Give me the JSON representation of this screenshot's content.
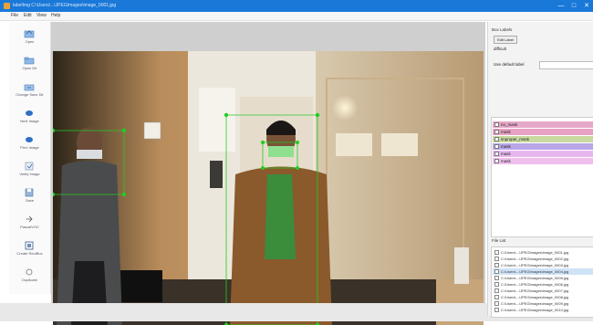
{
  "window": {
    "title": "labelImg C:\\Users\\...\\JPEGImages\\image_0001.jpg",
    "controls": [
      "—",
      "□",
      "✕"
    ]
  },
  "menu": [
    "File",
    "Edit",
    "View",
    "Help"
  ],
  "toolbar": [
    {
      "label": "Open",
      "icon": "open-icon"
    },
    {
      "label": "Open Dir",
      "icon": "open-dir-icon"
    },
    {
      "label": "Change Save Dir",
      "icon": "change-save-dir-icon"
    },
    {
      "label": "Next Image",
      "icon": "next-image-icon"
    },
    {
      "label": "Prev Image",
      "icon": "prev-image-icon"
    },
    {
      "label": "Verify Image",
      "icon": "verify-image-icon"
    },
    {
      "label": "Save",
      "icon": "save-icon"
    },
    {
      "label": "PascalVOC",
      "icon": "format-icon"
    },
    {
      "label": "Create RectBox",
      "icon": "create-rectbox-icon"
    },
    {
      "label": "Duplicate",
      "icon": "duplicate-icon"
    }
  ],
  "box_labels": {
    "title": "Box Labels",
    "edit_button": "Edit Label",
    "difficult": "difficult",
    "default_label_text": "Use default label"
  },
  "labels": [
    {
      "text": "no_mask",
      "color": "#e6a8c8"
    },
    {
      "text": "mask",
      "color": "#e8a0c4"
    },
    {
      "text": "improper_mask",
      "color": "#c9d9a0"
    },
    {
      "text": "mask",
      "color": "#b9a6e8"
    },
    {
      "text": "mask",
      "color": "#e7b6ef"
    },
    {
      "text": "mask",
      "color": "#f0c0ec"
    }
  ],
  "file_list": {
    "title": "File List",
    "files": [
      "C:\\Users\\...\\JPEGImages\\image_0001.jpg",
      "C:\\Users\\...\\JPEGImages\\image_0002.jpg",
      "C:\\Users\\...\\JPEGImages\\image_0003.jpg",
      "C:\\Users\\...\\JPEGImages\\image_0004.jpg",
      "C:\\Users\\...\\JPEGImages\\image_0005.jpg",
      "C:\\Users\\...\\JPEGImages\\image_0006.jpg",
      "C:\\Users\\...\\JPEGImages\\image_0007.jpg",
      "C:\\Users\\...\\JPEGImages\\image_0008.jpg",
      "C:\\Users\\...\\JPEGImages\\image_0009.jpg",
      "C:\\Users\\...\\JPEGImages\\image_0010.jpg"
    ]
  },
  "colors": {
    "titlebar": "#1a78d8",
    "bbox_line": "#22cc22"
  }
}
